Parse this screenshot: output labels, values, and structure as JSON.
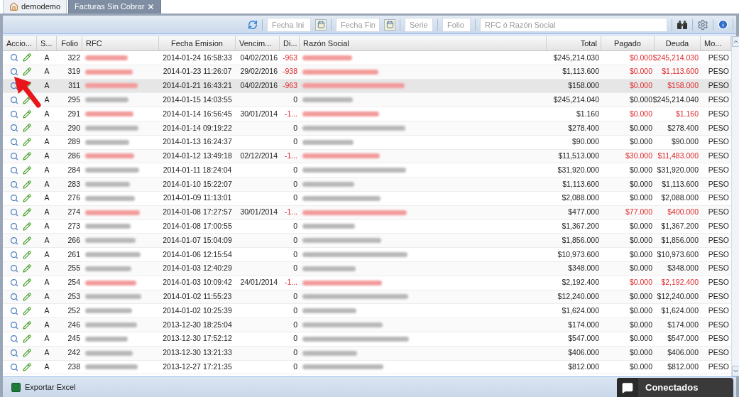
{
  "tabs": [
    {
      "label": "demodemo",
      "kind": "home",
      "selected": false
    },
    {
      "label": "Facturas Sin Cobrar",
      "kind": "closable",
      "selected": true
    }
  ],
  "toolbar": {
    "fields": [
      {
        "placeholder": "Fecha Ini",
        "kind": "date"
      },
      {
        "placeholder": "Fecha Fin",
        "kind": "date"
      },
      {
        "placeholder": "Serie",
        "kind": "text"
      },
      {
        "placeholder": "Folio",
        "kind": "text"
      },
      {
        "placeholder": "RFC ó Razón Social",
        "kind": "search"
      }
    ]
  },
  "table": {
    "columns": [
      "Accio...",
      "S...",
      "Folio",
      "RFC",
      "Fecha Emision",
      "Vencim...",
      "Di...",
      "Razón Social",
      "Total",
      "Pagado",
      "Deuda",
      "Mo..."
    ],
    "rows": [
      {
        "status": "A",
        "folio": "322",
        "fecha": "2014-01-24 16:58:33",
        "vencimiento": "04/02/2016",
        "dias": "-963",
        "total": "$245,214.030",
        "pagado": "$0.000",
        "deuda": "$245,214.030",
        "moneda": "PESO",
        "overdue": true,
        "selected": false
      },
      {
        "status": "A",
        "folio": "319",
        "fecha": "2014-01-23 11:26:07",
        "vencimiento": "29/02/2016",
        "dias": "-938",
        "total": "$1,113.600",
        "pagado": "$0.000",
        "deuda": "$1,113.600",
        "moneda": "PESO",
        "overdue": true,
        "selected": false
      },
      {
        "status": "A",
        "folio": "311",
        "fecha": "2014-01-21 16:43:21",
        "vencimiento": "04/02/2016",
        "dias": "-963",
        "total": "$158.000",
        "pagado": "$0.000",
        "deuda": "$158.000",
        "moneda": "PESO",
        "overdue": true,
        "selected": true
      },
      {
        "status": "A",
        "folio": "295",
        "fecha": "2014-01-15 14:03:55",
        "dias": "0",
        "total": "$245,214.040",
        "pagado": "$0.000",
        "deuda": "$245,214.040",
        "moneda": "PESO",
        "overdue": false,
        "selected": false
      },
      {
        "status": "A",
        "folio": "291",
        "fecha": "2014-01-14 16:56:45",
        "vencimiento": "30/01/2014",
        "dias": "-1...",
        "total": "$1.160",
        "pagado": "$0.000",
        "deuda": "$1.160",
        "moneda": "PESO",
        "overdue": true,
        "selected": false
      },
      {
        "status": "A",
        "folio": "290",
        "fecha": "2014-01-14 09:19:22",
        "dias": "0",
        "total": "$278.400",
        "pagado": "$0.000",
        "deuda": "$278.400",
        "moneda": "PESO",
        "overdue": false,
        "selected": false
      },
      {
        "status": "A",
        "folio": "289",
        "fecha": "2014-01-13 16:24:37",
        "dias": "0",
        "total": "$90.000",
        "pagado": "$0.000",
        "deuda": "$90.000",
        "moneda": "PESO",
        "overdue": false,
        "selected": false
      },
      {
        "status": "A",
        "folio": "286",
        "fecha": "2014-01-12 13:49:18",
        "vencimiento": "02/12/2014",
        "dias": "-1...",
        "total": "$11,513.000",
        "pagado": "$30.000",
        "deuda": "$11,483.000",
        "moneda": "PESO",
        "overdue": true,
        "selected": false
      },
      {
        "status": "A",
        "folio": "284",
        "fecha": "2014-01-11 18:24:04",
        "dias": "0",
        "total": "$31,920.000",
        "pagado": "$0.000",
        "deuda": "$31,920.000",
        "moneda": "PESO",
        "overdue": false,
        "selected": false
      },
      {
        "status": "A",
        "folio": "283",
        "fecha": "2014-01-10 15:22:07",
        "dias": "0",
        "total": "$1,113.600",
        "pagado": "$0.000",
        "deuda": "$1,113.600",
        "moneda": "PESO",
        "overdue": false,
        "selected": false
      },
      {
        "status": "A",
        "folio": "276",
        "fecha": "2014-01-09 11:13:01",
        "dias": "0",
        "total": "$2,088.000",
        "pagado": "$0.000",
        "deuda": "$2,088.000",
        "moneda": "PESO",
        "overdue": false,
        "selected": false
      },
      {
        "status": "A",
        "folio": "274",
        "fecha": "2014-01-08 17:27:57",
        "vencimiento": "30/01/2014",
        "dias": "-1...",
        "total": "$477.000",
        "pagado": "$77.000",
        "deuda": "$400.000",
        "moneda": "PESO",
        "overdue": true,
        "selected": false
      },
      {
        "status": "A",
        "folio": "273",
        "fecha": "2014-01-08 17:00:55",
        "dias": "0",
        "total": "$1,367.200",
        "pagado": "$0.000",
        "deuda": "$1,367.200",
        "moneda": "PESO",
        "overdue": false,
        "selected": false
      },
      {
        "status": "A",
        "folio": "266",
        "fecha": "2014-01-07 15:04:09",
        "dias": "0",
        "total": "$1,856.000",
        "pagado": "$0.000",
        "deuda": "$1,856.000",
        "moneda": "PESO",
        "overdue": false,
        "selected": false
      },
      {
        "status": "A",
        "folio": "261",
        "fecha": "2014-01-06 12:15:54",
        "dias": "0",
        "total": "$10,973.600",
        "pagado": "$0.000",
        "deuda": "$10,973.600",
        "moneda": "PESO",
        "overdue": false,
        "selected": false
      },
      {
        "status": "A",
        "folio": "255",
        "fecha": "2014-01-03 12:40:29",
        "dias": "0",
        "total": "$348.000",
        "pagado": "$0.000",
        "deuda": "$348.000",
        "moneda": "PESO",
        "overdue": false,
        "selected": false
      },
      {
        "status": "A",
        "folio": "254",
        "fecha": "2014-01-03 10:09:42",
        "vencimiento": "24/01/2014",
        "dias": "-1...",
        "total": "$2,192.400",
        "pagado": "$0.000",
        "deuda": "$2,192.400",
        "moneda": "PESO",
        "overdue": true,
        "selected": false
      },
      {
        "status": "A",
        "folio": "253",
        "fecha": "2014-01-02 11:55:23",
        "dias": "0",
        "total": "$12,240.000",
        "pagado": "$0.000",
        "deuda": "$12,240.000",
        "moneda": "PESO",
        "overdue": false,
        "selected": false
      },
      {
        "status": "A",
        "folio": "252",
        "fecha": "2014-01-02 10:25:39",
        "dias": "0",
        "total": "$1,624.000",
        "pagado": "$0.000",
        "deuda": "$1,624.000",
        "moneda": "PESO",
        "overdue": false,
        "selected": false
      },
      {
        "status": "A",
        "folio": "246",
        "fecha": "2013-12-30 18:25:04",
        "dias": "0",
        "total": "$174.000",
        "pagado": "$0.000",
        "deuda": "$174.000",
        "moneda": "PESO",
        "overdue": false,
        "selected": false
      },
      {
        "status": "A",
        "folio": "245",
        "fecha": "2013-12-30 17:52:12",
        "dias": "0",
        "total": "$547.000",
        "pagado": "$0.000",
        "deuda": "$547.000",
        "moneda": "PESO",
        "overdue": false,
        "selected": false
      },
      {
        "status": "A",
        "folio": "242",
        "fecha": "2013-12-30 13:21:33",
        "dias": "0",
        "total": "$406.000",
        "pagado": "$0.000",
        "deuda": "$406.000",
        "moneda": "PESO",
        "overdue": false,
        "selected": false
      },
      {
        "status": "A",
        "folio": "238",
        "fecha": "2013-12-27 17:21:35",
        "dias": "0",
        "total": "$812.000",
        "pagado": "$0.000",
        "deuda": "$812.000",
        "moneda": "PESO",
        "overdue": false,
        "selected": false
      }
    ]
  },
  "footer": {
    "export_button": "Exportar Excel"
  },
  "chat": {
    "label": "Conectados"
  }
}
